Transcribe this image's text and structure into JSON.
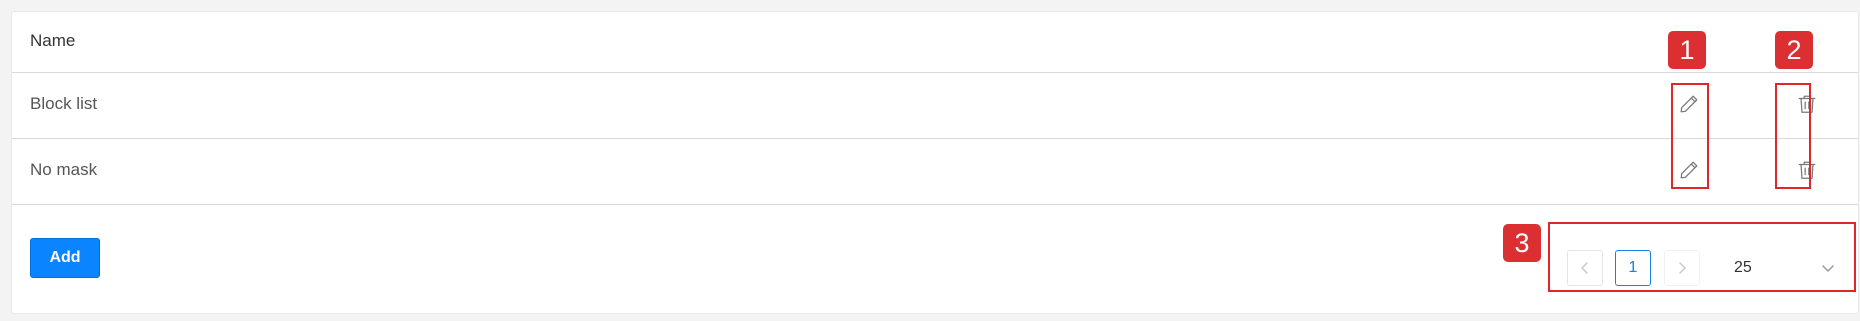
{
  "table": {
    "header": {
      "name_label": "Name"
    },
    "rows": [
      {
        "name": "Block list"
      },
      {
        "name": "No mask"
      }
    ]
  },
  "footer": {
    "add_label": "Add",
    "pagination": {
      "current_page": "1",
      "page_size": "25"
    }
  },
  "annotations": {
    "badge_1": "1",
    "badge_2": "2",
    "badge_3": "3"
  },
  "icons": {
    "edit": "pencil-icon",
    "delete": "trash-icon",
    "prev": "chevron-left-icon",
    "next": "chevron-right-icon",
    "dropdown": "chevron-down-icon"
  },
  "colors": {
    "primary": "#0a84ff",
    "highlight": "#e0262b",
    "badge": "#dc2f31"
  }
}
